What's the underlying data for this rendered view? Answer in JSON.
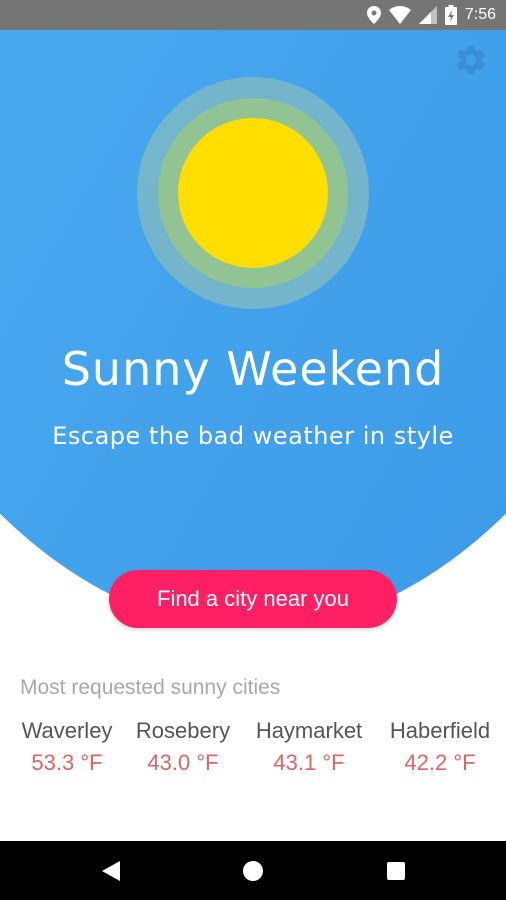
{
  "status_bar": {
    "time": "7:56",
    "icons": [
      "location-icon",
      "wifi-icon",
      "signal-icon",
      "battery-charging-icon"
    ]
  },
  "colors": {
    "hero_gradient_start": "#67c3f3",
    "hero_gradient_end": "#3896e6",
    "sun_core": "#ffde00",
    "cta_background": "#ff1f64",
    "temperature_text": "#e06464"
  },
  "hero": {
    "title": "Sunny Weekend",
    "subtitle": "Escape the bad weather in style",
    "settings_icon": "gear-icon"
  },
  "cta": {
    "label": "Find a city near you"
  },
  "cities": {
    "heading": "Most requested sunny cities",
    "items": [
      {
        "name": "Waverley",
        "temp": "53.3 °F"
      },
      {
        "name": "Rosebery",
        "temp": "43.0 °F"
      },
      {
        "name": "Haymarket",
        "temp": "43.1 °F"
      },
      {
        "name": "Haberfield",
        "temp": "42.2 °F"
      }
    ]
  },
  "nav_bar": {
    "buttons": [
      "back-icon",
      "home-icon",
      "recents-icon"
    ]
  }
}
